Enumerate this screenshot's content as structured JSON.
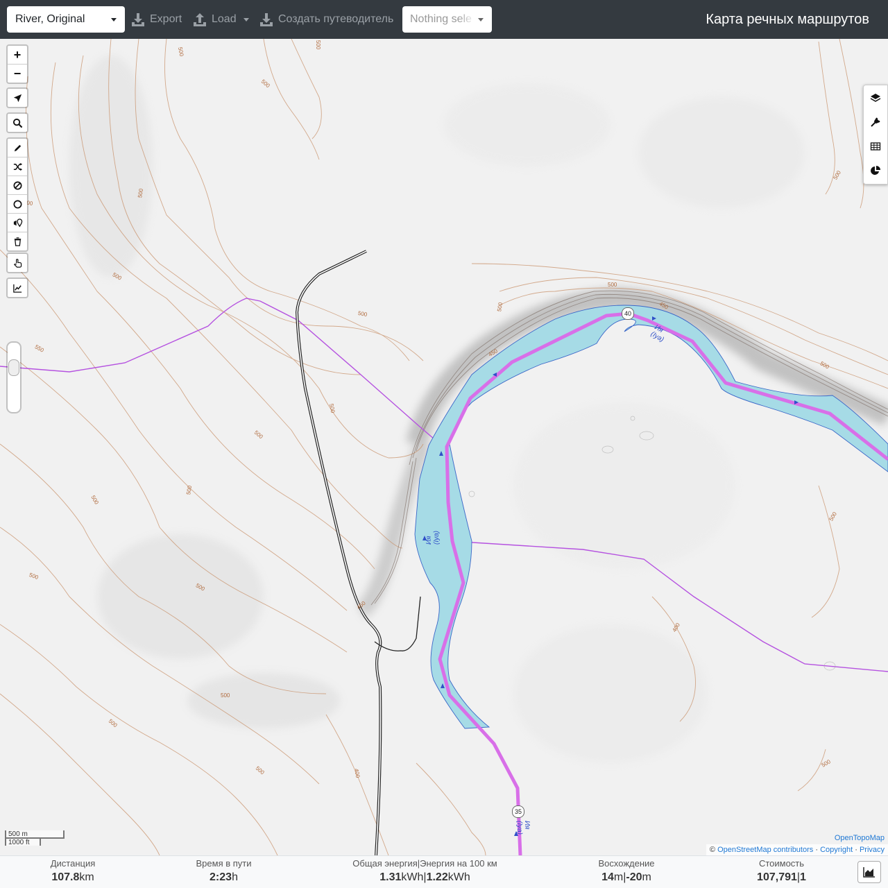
{
  "header": {
    "profile_select": "River, Original",
    "export_label": "Export",
    "load_label": "Load",
    "guide_label": "Создать путеводитель",
    "selection_placeholder": "Nothing sele",
    "app_title": "Карта речных маршрутов"
  },
  "map": {
    "zoom_in": "+",
    "zoom_out": "−",
    "river_name": "Ия",
    "river_name_latin": "(Iya)",
    "road_shield_1": "40",
    "road_shield_2": "35",
    "contour_labels": [
      "500",
      "450",
      "550",
      "600",
      "400"
    ],
    "scale_metric": "500 m",
    "scale_imperial": "1000 ft",
    "attribution_provider": "OpenTopoMap",
    "attribution_osm": "OpenStreetMap contributors",
    "attribution_copyright": "Copyright",
    "attribution_privacy": "Privacy",
    "attribution_prefix": "©",
    "attribution_sep": "·",
    "colors": {
      "route": "#d86fe8",
      "water": "#a6dbe6",
      "water_edge": "#3a66c8",
      "contour": "#c89068",
      "boundary": "#b552e0"
    }
  },
  "stats": {
    "distance": {
      "label": "Дистанция",
      "value": "107.8",
      "unit": "km"
    },
    "time": {
      "label": "Время в пути",
      "value": "2:23",
      "unit": "h"
    },
    "energy": {
      "label": "Общая энергия|Энергия на 100 км",
      "value1": "1.31",
      "unit1": "kWh",
      "sep": "|",
      "value2": "1.22",
      "unit2": "kWh"
    },
    "ascent": {
      "label": "Восхождение",
      "value1": "14",
      "unit1": "m",
      "sep": "|",
      "value2": "-20",
      "unit2": "m"
    },
    "cost": {
      "label": "Стоимость",
      "value": "107,791",
      "sep": "|",
      "value2": "1"
    }
  }
}
